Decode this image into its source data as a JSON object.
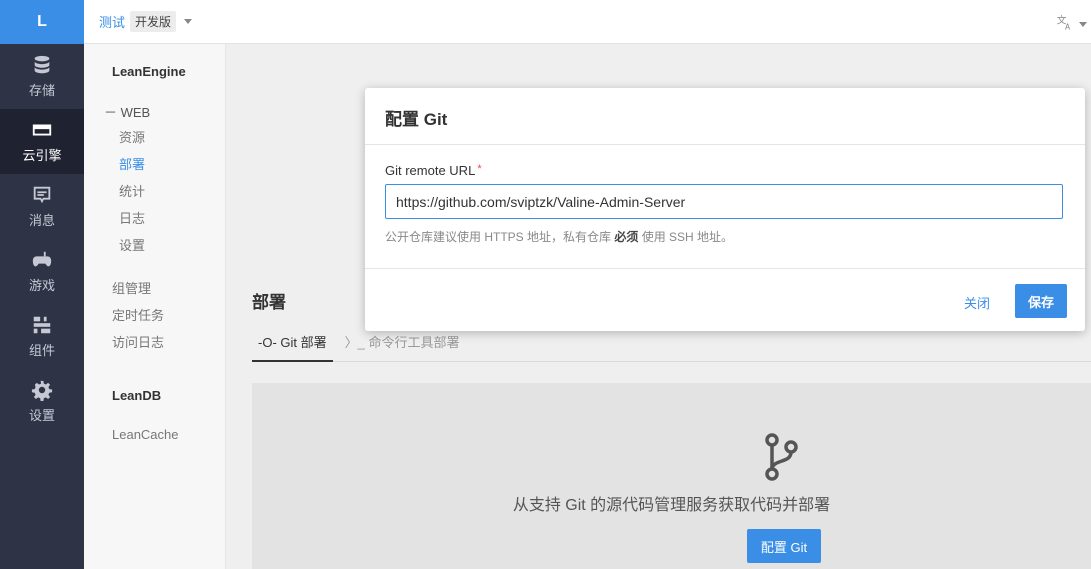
{
  "rail": {
    "logo": "L",
    "items": [
      {
        "label": "存储",
        "icon": "database-icon"
      },
      {
        "label": "云引擎",
        "icon": "cloud-engine-icon"
      },
      {
        "label": "消息",
        "icon": "message-icon"
      },
      {
        "label": "游戏",
        "icon": "gamepad-icon"
      },
      {
        "label": "组件",
        "icon": "components-icon"
      },
      {
        "label": "设置",
        "icon": "gear-icon"
      }
    ],
    "active_index": 1
  },
  "topbar": {
    "app_name": "测试",
    "badge": "开发版",
    "lang_icon": "translate-icon"
  },
  "subnav": {
    "engine_title": "LeanEngine",
    "web_head": "－ WEB",
    "web_items": [
      "资源",
      "部署",
      "统计",
      "日志",
      "设置"
    ],
    "active_item": "部署",
    "other_items": [
      "组管理",
      "定时任务",
      "访问日志"
    ],
    "db_title": "LeanDB",
    "cache_item": "LeanCache"
  },
  "main": {
    "section_title": "部署",
    "tabs": [
      "-O- Git 部署",
      "〉_ 命令行工具部署"
    ],
    "deploy_text": "从支持 Git 的源代码管理服务获取代码并部署",
    "deploy_button": "配置 Git"
  },
  "modal": {
    "title": "配置 Git",
    "field_label": "Git remote URL",
    "required_mark": "*",
    "url_value": "https://github.com/sviptzk/Valine-Admin-Server",
    "help_prefix": "公开仓库建议使用 HTTPS 地址，私有仓库 ",
    "help_bold": "必须",
    "help_suffix": " 使用 SSH 地址。",
    "close_label": "关闭",
    "save_label": "保存"
  },
  "colors": {
    "accent": "#3a8ee6",
    "rail_bg": "#2f3346",
    "rail_active_bg": "#1f2231"
  }
}
